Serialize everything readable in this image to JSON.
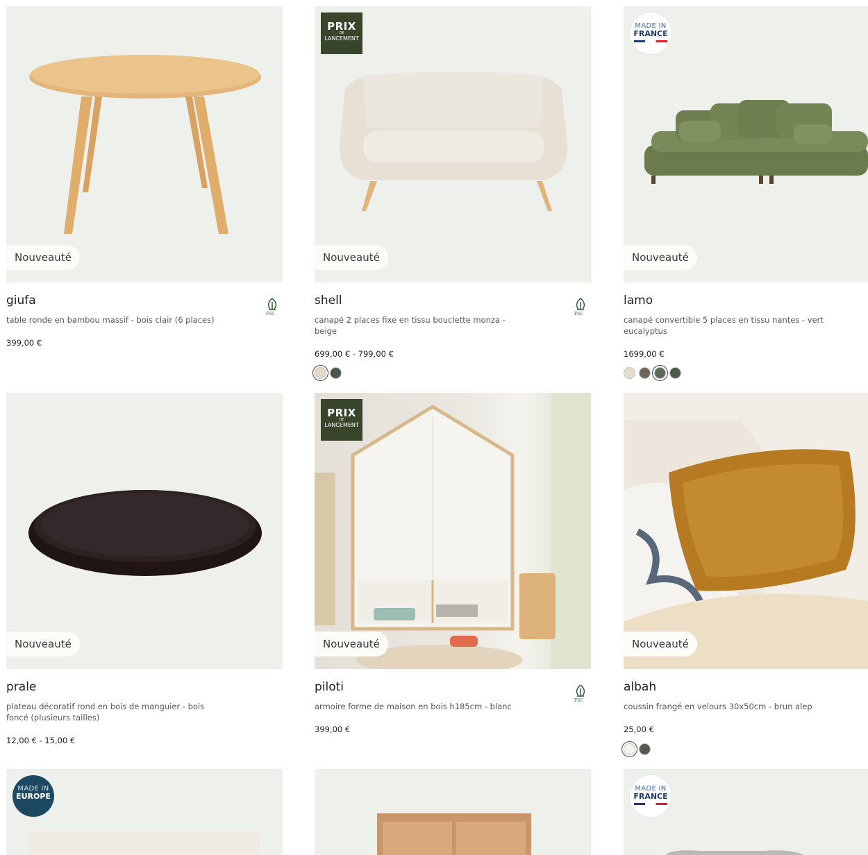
{
  "labels": {
    "new": "Nouveauté",
    "prix_line1": "PRIX",
    "prix_line2": "DE",
    "prix_line3": "LANCEMENT",
    "made_in": "MADE IN",
    "france": "FRANCE",
    "europe": "EUROPE",
    "fsc": "FSC"
  },
  "products": [
    {
      "name": "giufa",
      "description": "table ronde en bambou massif - bois clair (6 places)",
      "price": "399,00 €",
      "fsc": true,
      "badge": "",
      "colors": []
    },
    {
      "name": "shell",
      "description": "canapé 2 places fixe en tissu bouclette monza - beige",
      "price": "699,00 € - 799,00 €",
      "fsc": true,
      "badge": "prix-de-lancement",
      "colors": [
        "#e4d8c6",
        "#4b554b"
      ]
    },
    {
      "name": "lamo",
      "description": "canapé convertible 5 places en tissu nantes - vert eucalyptus",
      "price": "1699,00 €",
      "fsc": false,
      "badge": "made-in-france",
      "colors": [
        "#e6dccd",
        "#6f6457",
        "#5b6957",
        "#4c5a4c"
      ]
    },
    {
      "name": "prale",
      "description": "plateau décoratif rond en bois de manguier - bois foncé (plusieurs tailles)",
      "price": "12,00 € - 15,00 €",
      "fsc": false,
      "badge": "",
      "colors": []
    },
    {
      "name": "piloti",
      "description": "armoire forme de maison en bois h185cm - blanc",
      "price": "399,00 €",
      "fsc": true,
      "badge": "prix-de-lancement",
      "colors": []
    },
    {
      "name": "albah",
      "description": "coussin frangé en velours 30x50cm - brun alep",
      "price": "25,00 €",
      "fsc": false,
      "badge": "",
      "colors": [
        "#f4f3ee",
        "#53594f"
      ]
    }
  ]
}
